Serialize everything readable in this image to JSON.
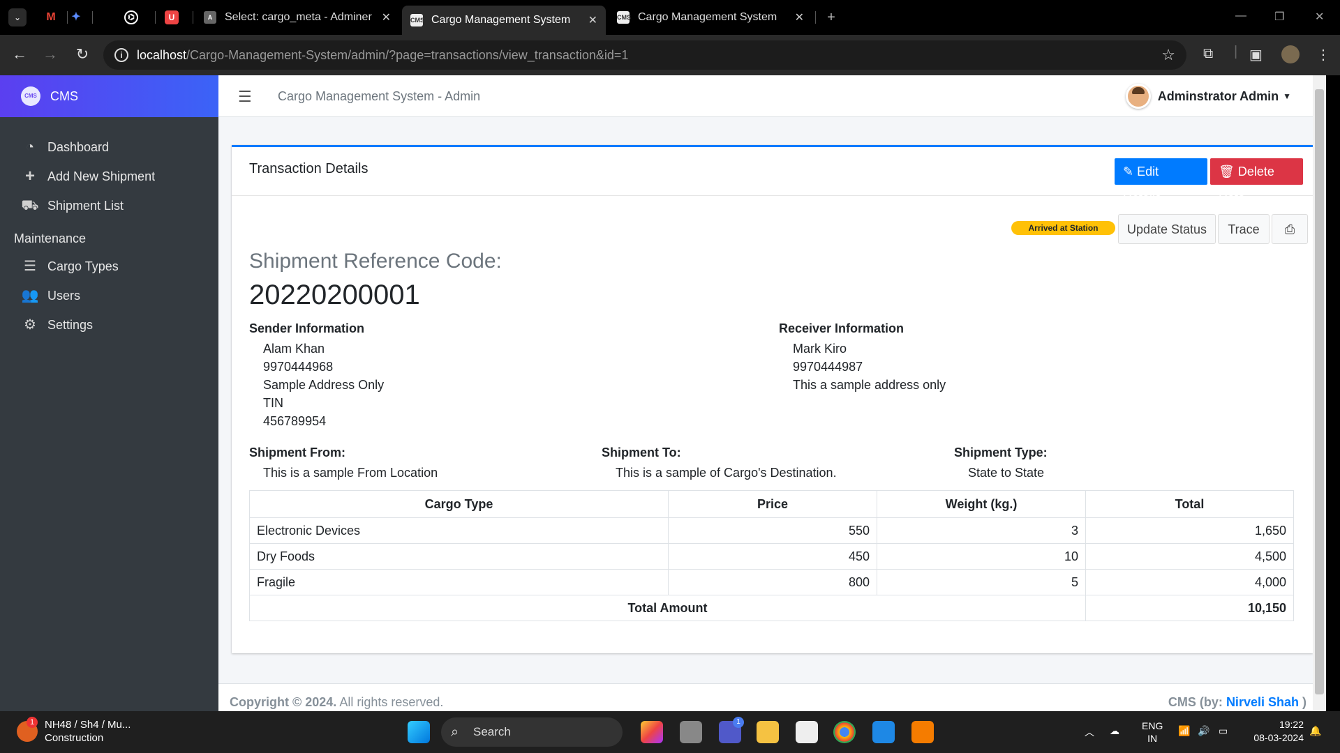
{
  "browser": {
    "tabs": [
      {
        "title": "Select: cargo_meta - Adminer",
        "active": false
      },
      {
        "title": "Cargo Management System",
        "active": true
      },
      {
        "title": "Cargo Management System",
        "active": false
      }
    ],
    "url_host": "localhost",
    "url_path": "/Cargo-Management-System/admin/?page=transactions/view_transaction&id=1"
  },
  "sidebar": {
    "brand": "CMS",
    "items": [
      {
        "label": "Dashboard",
        "icon": "tachometer-icon"
      },
      {
        "label": "Add New Shipment",
        "icon": "plus-icon"
      },
      {
        "label": "Shipment List",
        "icon": "truck-loading-icon"
      }
    ],
    "maintenance_header": "Maintenance",
    "maintenance_items": [
      {
        "label": "Cargo Types",
        "icon": "list-icon"
      },
      {
        "label": "Users",
        "icon": "users-icon"
      },
      {
        "label": "Settings",
        "icon": "cogs-icon"
      }
    ]
  },
  "topnav": {
    "title": "Cargo Management System - Admin",
    "user": "Adminstrator Admin"
  },
  "card": {
    "title": "Transaction Details",
    "edit_label": "Edit Details",
    "delete_label": "Delete Data",
    "status_badge": "Arrived at Station",
    "update_status_label": "Update Status",
    "trace_label": "Trace",
    "ref_label": "Shipment Reference Code:",
    "ref_code": "20220200001",
    "sender": {
      "header": "Sender Information",
      "lines": [
        "Alam Khan",
        "9970444968",
        "Sample Address Only",
        "TIN",
        "456789954"
      ]
    },
    "receiver": {
      "header": "Receiver Information",
      "lines": [
        "Mark Kiro",
        "9970444987",
        "This a sample address only"
      ]
    },
    "from": {
      "header": "Shipment From:",
      "value": "This is a sample From Location"
    },
    "to": {
      "header": "Shipment To:",
      "value": "This is a sample of Cargo's Destination."
    },
    "type": {
      "header": "Shipment Type:",
      "value": "State to State"
    },
    "table": {
      "headers": [
        "Cargo Type",
        "Price",
        "Weight (kg.)",
        "Total"
      ],
      "rows": [
        [
          "Electronic Devices",
          "550",
          "3",
          "1,650"
        ],
        [
          "Dry Foods",
          "450",
          "10",
          "4,500"
        ],
        [
          "Fragile",
          "800",
          "5",
          "4,000"
        ]
      ],
      "total_label": "Total Amount",
      "total_value": "10,150"
    }
  },
  "footer": {
    "copyright": "Copyright © 2024.",
    "rights": "All rights reserved.",
    "credit_prefix": "CMS (by:",
    "credit_name": "Nirveli Shah",
    "credit_suffix": ")"
  },
  "taskbar": {
    "weather_title": "NH48 / Sh4 / Mu...",
    "weather_sub": "Construction",
    "weather_badge": "1",
    "search": "Search",
    "lang1": "ENG",
    "lang2": "IN",
    "time": "19:22",
    "date": "08-03-2024",
    "teams_badge": "1"
  }
}
